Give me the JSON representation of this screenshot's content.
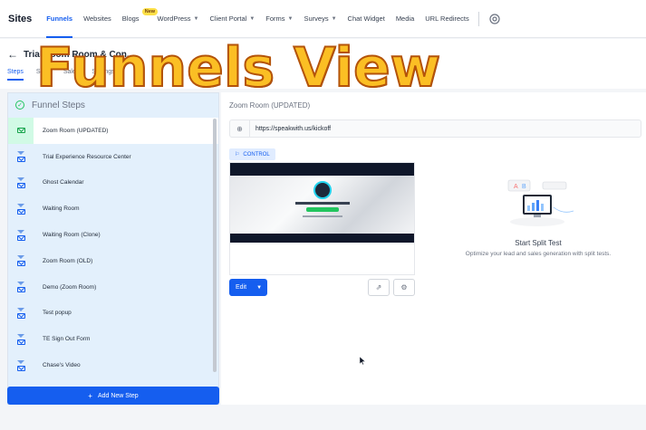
{
  "nav": {
    "brand": "Sites",
    "items": [
      {
        "label": "Funnels",
        "active": true,
        "dropdown": false
      },
      {
        "label": "Websites",
        "active": false,
        "dropdown": false
      },
      {
        "label": "Blogs",
        "active": false,
        "dropdown": false,
        "badge": "New"
      },
      {
        "label": "WordPress",
        "active": false,
        "dropdown": true
      },
      {
        "label": "Client Portal",
        "active": false,
        "dropdown": true
      },
      {
        "label": "Forms",
        "active": false,
        "dropdown": true
      },
      {
        "label": "Surveys",
        "active": false,
        "dropdown": true
      },
      {
        "label": "Chat Widget",
        "active": false,
        "dropdown": false
      },
      {
        "label": "Media",
        "active": false,
        "dropdown": false
      },
      {
        "label": "URL Redirects",
        "active": false,
        "dropdown": false
      }
    ],
    "settings_icon": "gear-icon"
  },
  "subheader": {
    "back_title": "Trial Zoom Room & Con...",
    "tabs": [
      "Steps",
      "Stats",
      "Sales",
      "Settings"
    ]
  },
  "overlay_text": "Funnels View",
  "funnel_steps": {
    "title": "Funnel Steps",
    "steps": [
      "Zoom Room (UPDATED)",
      "Trial Experience Resource Center",
      "Ghost Calendar",
      "Waiting Room",
      "Waiting Room (Clone)",
      "Zoom Room (OLD)",
      "Demo (Zoom Room)",
      "Test popup",
      "TE Sign Out Form",
      "Chase's Video"
    ],
    "add_label": "Add New Step"
  },
  "main": {
    "page_name": "Zoom Room (UPDATED)",
    "url": "https://speakwith.us/kickoff",
    "control_label": "CONTROL",
    "edit_label": "Edit",
    "split_title": "Start Split Test",
    "split_subtitle": "Optimize your lead and sales generation with split tests."
  },
  "colors": {
    "accent": "#155eef",
    "overlay": "#fbbf24",
    "panel": "#e3f0fc"
  }
}
